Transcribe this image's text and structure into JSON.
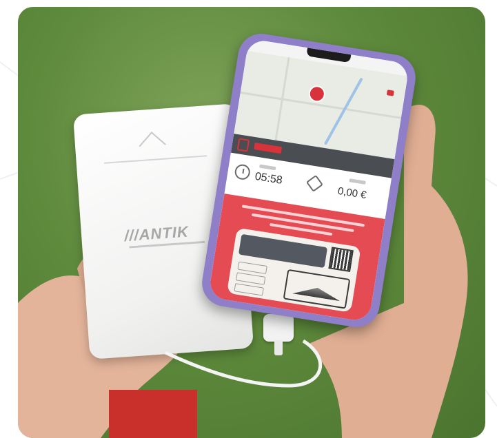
{
  "photo": {
    "subject": "hands holding power bank and smartphone",
    "background_color": "#5e8a3c"
  },
  "powerbank": {
    "brand": "///ANTIK"
  },
  "phone": {
    "screen": {
      "time_value": "05:58",
      "price_value": "0,00 €"
    },
    "frame_color": "#8f7fc9",
    "accent_color": "#e44b53"
  },
  "icons": [
    "clock-icon",
    "tag-icon",
    "map-pin-icon",
    "chevron-up-icon"
  ]
}
